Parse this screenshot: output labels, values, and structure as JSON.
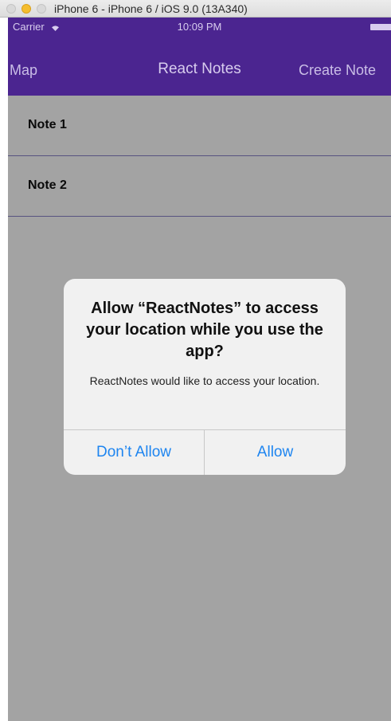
{
  "window": {
    "title": "iPhone 6 - iPhone 6 / iOS 9.0 (13A340)"
  },
  "status_bar": {
    "carrier": "Carrier",
    "time": "10:09 PM"
  },
  "nav": {
    "left": "Map",
    "title": "React Notes",
    "right": "Create Note"
  },
  "notes": [
    {
      "label": "Note 1"
    },
    {
      "label": "Note 2"
    }
  ],
  "alert": {
    "title": "Allow “ReactNotes” to access your location while you use the app?",
    "message": "ReactNotes would like to access your location.",
    "deny_label": "Don’t Allow",
    "allow_label": "Allow"
  },
  "colors": {
    "nav_background": "#4b2590",
    "alert_button": "#1e85f0",
    "divider": "#8a82c8"
  }
}
